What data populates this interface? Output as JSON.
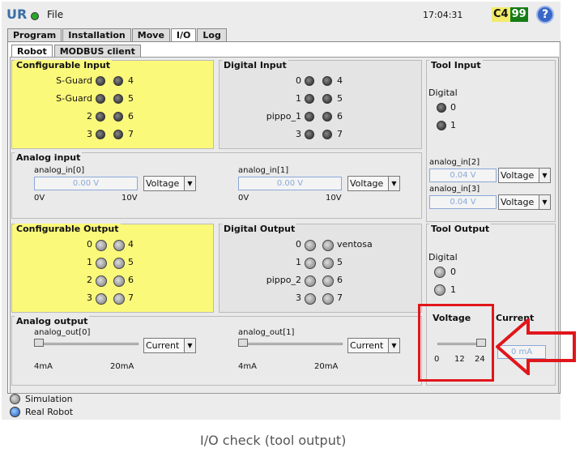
{
  "topbar": {
    "file": "File",
    "time": "17:04:31",
    "badge_a": "C4",
    "badge_b": "99",
    "help": "?"
  },
  "tabs": [
    "Program",
    "Installation",
    "Move",
    "I/O",
    "Log"
  ],
  "subtabs": [
    "Robot",
    "MODBUS client"
  ],
  "conf_input": {
    "title": "Configurable Input",
    "left": [
      "S-Guard",
      "S-Guard",
      "2",
      "3"
    ],
    "right": [
      "4",
      "5",
      "6",
      "7"
    ]
  },
  "dig_input": {
    "title": "Digital Input",
    "left": [
      "0",
      "1",
      "pippo_1",
      "3"
    ],
    "right": [
      "4",
      "5",
      "6",
      "7"
    ]
  },
  "tool_input": {
    "title": "Tool Input",
    "digital": "Digital",
    "items": [
      "0",
      "1"
    ],
    "analog": [
      {
        "name": "analog_in[2]",
        "value": "0.04 V",
        "mode": "Voltage"
      },
      {
        "name": "analog_in[3]",
        "value": "0.04 V",
        "mode": "Voltage"
      }
    ]
  },
  "analog_input": {
    "title": "Analog input",
    "ch": [
      {
        "name": "analog_in[0]",
        "value": "0.00 V",
        "mode": "Voltage",
        "min": "0V",
        "max": "10V"
      },
      {
        "name": "analog_in[1]",
        "value": "0.00 V",
        "mode": "Voltage",
        "min": "0V",
        "max": "10V"
      }
    ]
  },
  "conf_output": {
    "title": "Configurable Output",
    "left": [
      "0",
      "1",
      "2",
      "3"
    ],
    "right": [
      "4",
      "5",
      "6",
      "7"
    ]
  },
  "dig_output": {
    "title": "Digital Output",
    "left": [
      "0",
      "1",
      "pippo_2",
      "3"
    ],
    "right": [
      "ventosa",
      "5",
      "6",
      "7"
    ]
  },
  "tool_output": {
    "title": "Tool Output",
    "digital": "Digital",
    "items": [
      "0",
      "1"
    ],
    "voltage_title": "Voltage",
    "current_title": "Current",
    "voltage_ticks": [
      "0",
      "12",
      "24"
    ],
    "current_value": "0 mA",
    "voltage_level": 24
  },
  "analog_output": {
    "title": "Analog output",
    "ch": [
      {
        "name": "analog_out[0]",
        "mode": "Current",
        "min": "4mA",
        "max": "20mA",
        "level": 4
      },
      {
        "name": "analog_out[1]",
        "mode": "Current",
        "min": "4mA",
        "max": "20mA",
        "level": 4
      }
    ]
  },
  "status": {
    "sim": "Simulation",
    "real": "Real Robot"
  },
  "caption": "I/O check (tool output)",
  "colors": {
    "highlight": "#e0161b",
    "panel_yellow": "#fbf97a"
  }
}
